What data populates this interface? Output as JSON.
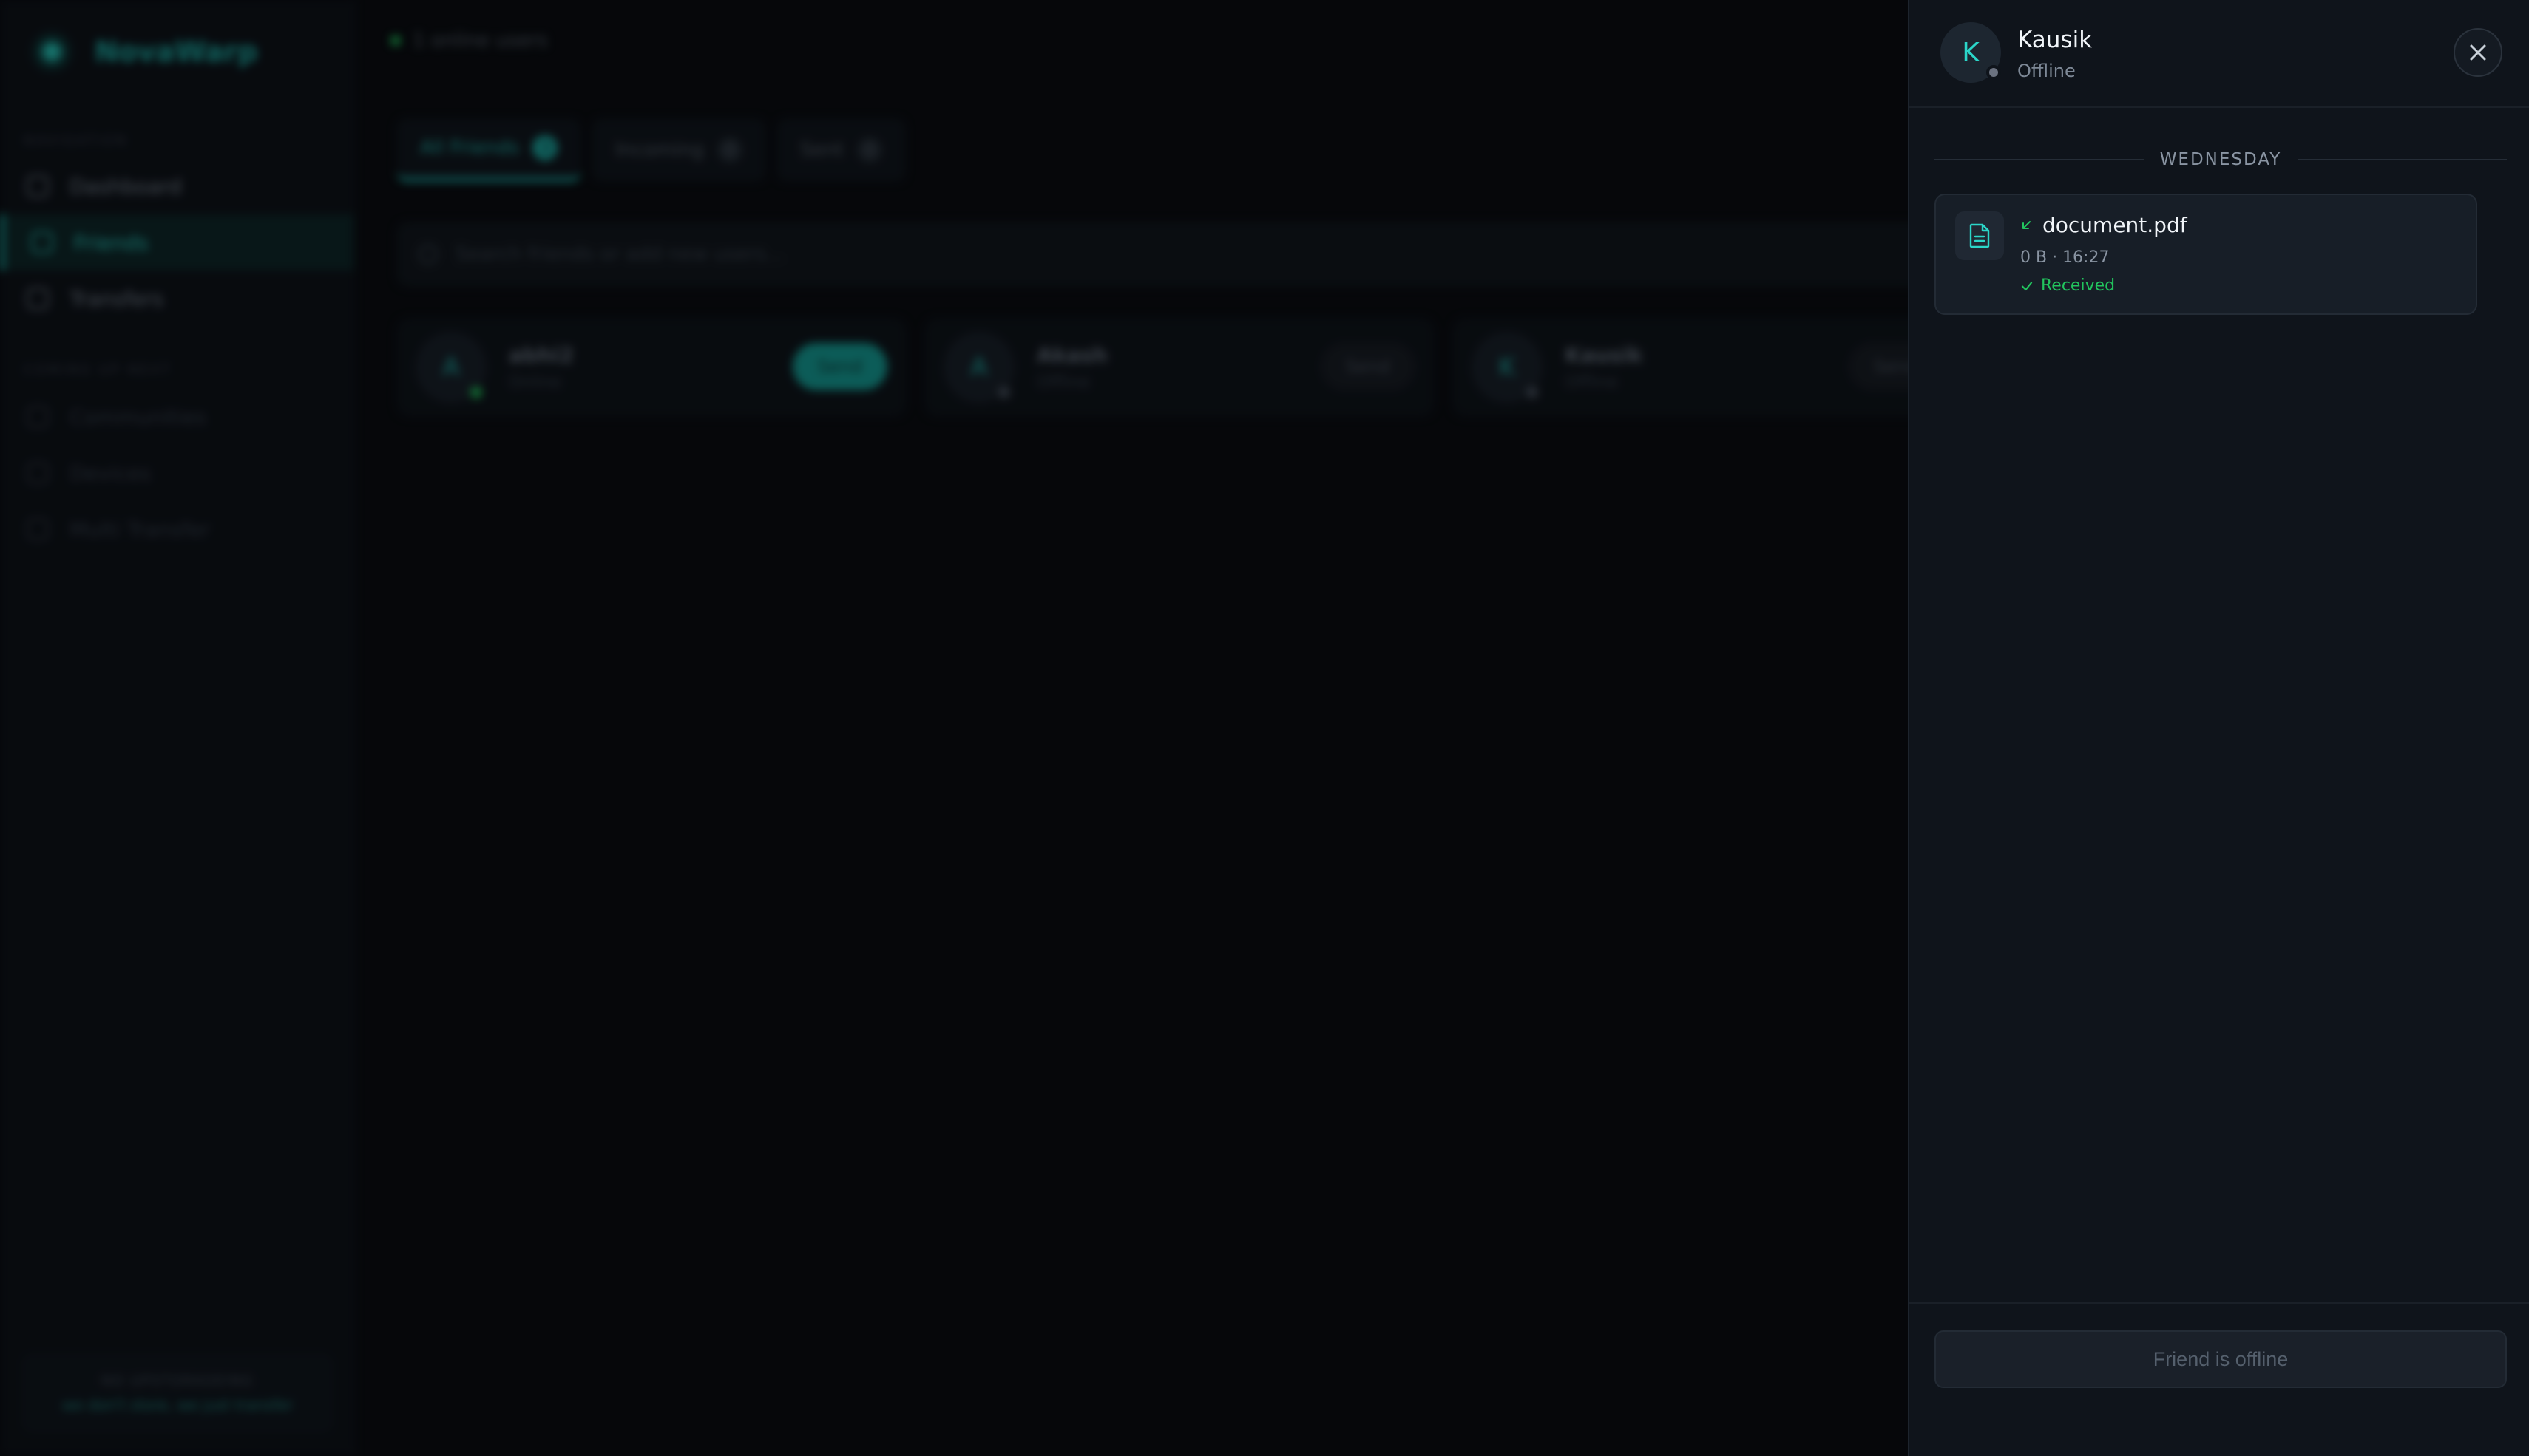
{
  "brand": {
    "name": "NovaWarp"
  },
  "sidebar": {
    "section_main": "NAVIGATION",
    "items": [
      {
        "label": "Dashboard"
      },
      {
        "label": "Friends"
      },
      {
        "label": "Transfers"
      }
    ],
    "section_coming": "COMING UP NEXT",
    "coming_items": [
      {
        "label": "Communities"
      },
      {
        "label": "Devices"
      },
      {
        "label": "Multi Transfer"
      }
    ],
    "footer": {
      "line1": "NO UPSTORAGEING",
      "line2": "we don't store, we just transfer"
    }
  },
  "main": {
    "online_text": "1 online users",
    "tabs": [
      {
        "label": "All Friends",
        "count": "3"
      },
      {
        "label": "Incoming",
        "count": "0"
      },
      {
        "label": "Sent",
        "count": "0"
      }
    ],
    "search_placeholder": "Search friends or add new users...",
    "friends": [
      {
        "initial": "A",
        "name": "abhi2",
        "status": "Online",
        "send": "Send"
      },
      {
        "initial": "A",
        "name": "Akash",
        "status": "Offline",
        "send": "Send"
      },
      {
        "initial": "K",
        "name": "Kausik",
        "status": "Offline",
        "send": "Send"
      }
    ]
  },
  "chat": {
    "avatar_initial": "K",
    "name": "Kausik",
    "status": "Offline",
    "day_label": "WEDNESDAY",
    "messages": [
      {
        "file_name": "document.pdf",
        "meta": "0 B · 16:27",
        "state": "Received"
      }
    ],
    "footer_button": "Friend is offline"
  },
  "colors": {
    "accent": "#2bd6c9",
    "success": "#22c55e",
    "panel_bg": "#0f141b"
  }
}
